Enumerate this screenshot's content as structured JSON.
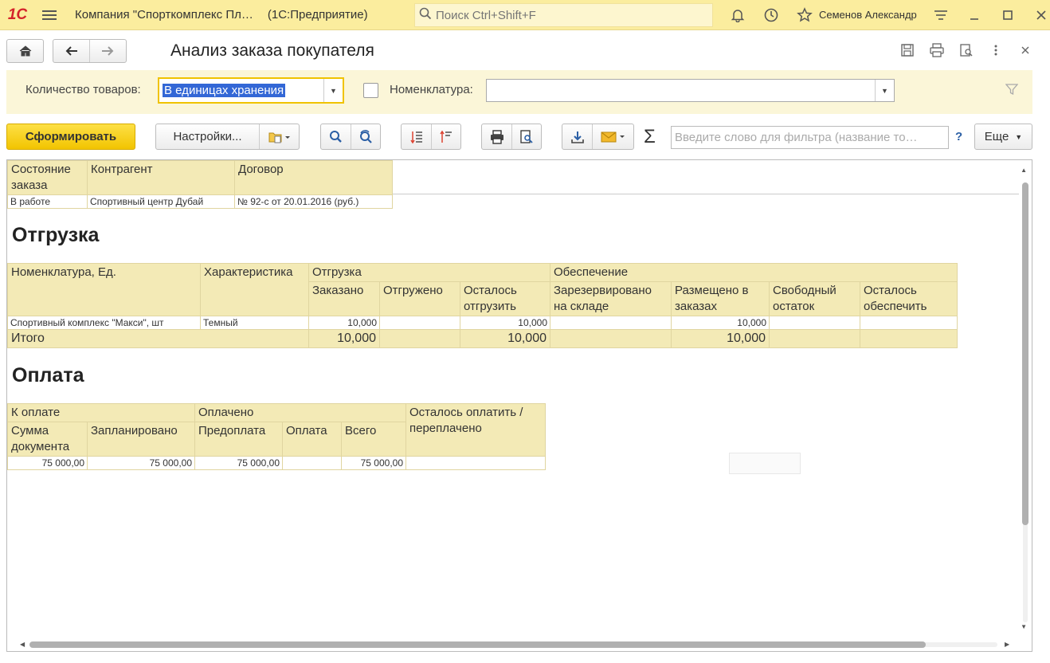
{
  "topbar": {
    "logo": "1С",
    "title": "Компания \"Спорткомплекс Пл…",
    "platform": "(1С:Предприятие)",
    "search_placeholder": "Поиск Ctrl+Shift+F",
    "user": "Семенов Александр"
  },
  "form": {
    "title": "Анализ заказа покупателя"
  },
  "filters": {
    "qty_label": "Количество товаров:",
    "qty_value": "В единицах хранения",
    "nomen_label": "Номенклатура:",
    "nomen_value": ""
  },
  "toolbar": {
    "generate": "Сформировать",
    "settings": "Настройки...",
    "filter_placeholder": "Введите слово для фильтра (название то…",
    "help": "?",
    "more": "Еще"
  },
  "report": {
    "header_table": {
      "columns": [
        "Состояние заказа",
        "Контрагент",
        "Договор"
      ],
      "row": [
        "В работе",
        "Спортивный центр Дубай",
        "№ 92-с от 20.01.2016 (руб.)"
      ]
    },
    "shipment": {
      "title": "Отгрузка",
      "col_nomen": "Номенклатура, Ед.",
      "col_char": "Характеристика",
      "group_ship": "Отгрузка",
      "group_supply": "Обеспечение",
      "col_ordered": "Заказано",
      "col_shipped": "Отгружено",
      "col_left_ship": "Осталось отгрузить",
      "col_reserved": "Зарезервировано на складе",
      "col_placed": "Размещено в заказах",
      "col_free": "Свободный остаток",
      "col_left_supply": "Осталось обеспечить",
      "row": {
        "nomen": "Спортивный комплекс \"Макси\", шт",
        "char": "Темный",
        "ordered": "10,000",
        "shipped": "",
        "left_ship": "10,000",
        "reserved": "",
        "placed": "10,000",
        "free": "",
        "left_supply": ""
      },
      "total_label": "Итого",
      "total": {
        "ordered": "10,000",
        "left_ship": "10,000",
        "placed": "10,000"
      }
    },
    "payment": {
      "title": "Оплата",
      "group_to_pay": "К оплате",
      "group_paid": "Оплачено",
      "col_left": "Осталось оплатить / переплачено",
      "col_doc_sum": "Сумма документа",
      "col_planned": "Запланировано",
      "col_prepay": "Предоплата",
      "col_pay": "Оплата",
      "col_total": "Всего",
      "row": {
        "doc_sum": "75 000,00",
        "planned": "75 000,00",
        "prepay": "75 000,00",
        "pay": "",
        "total": "75 000,00",
        "left": ""
      }
    }
  }
}
